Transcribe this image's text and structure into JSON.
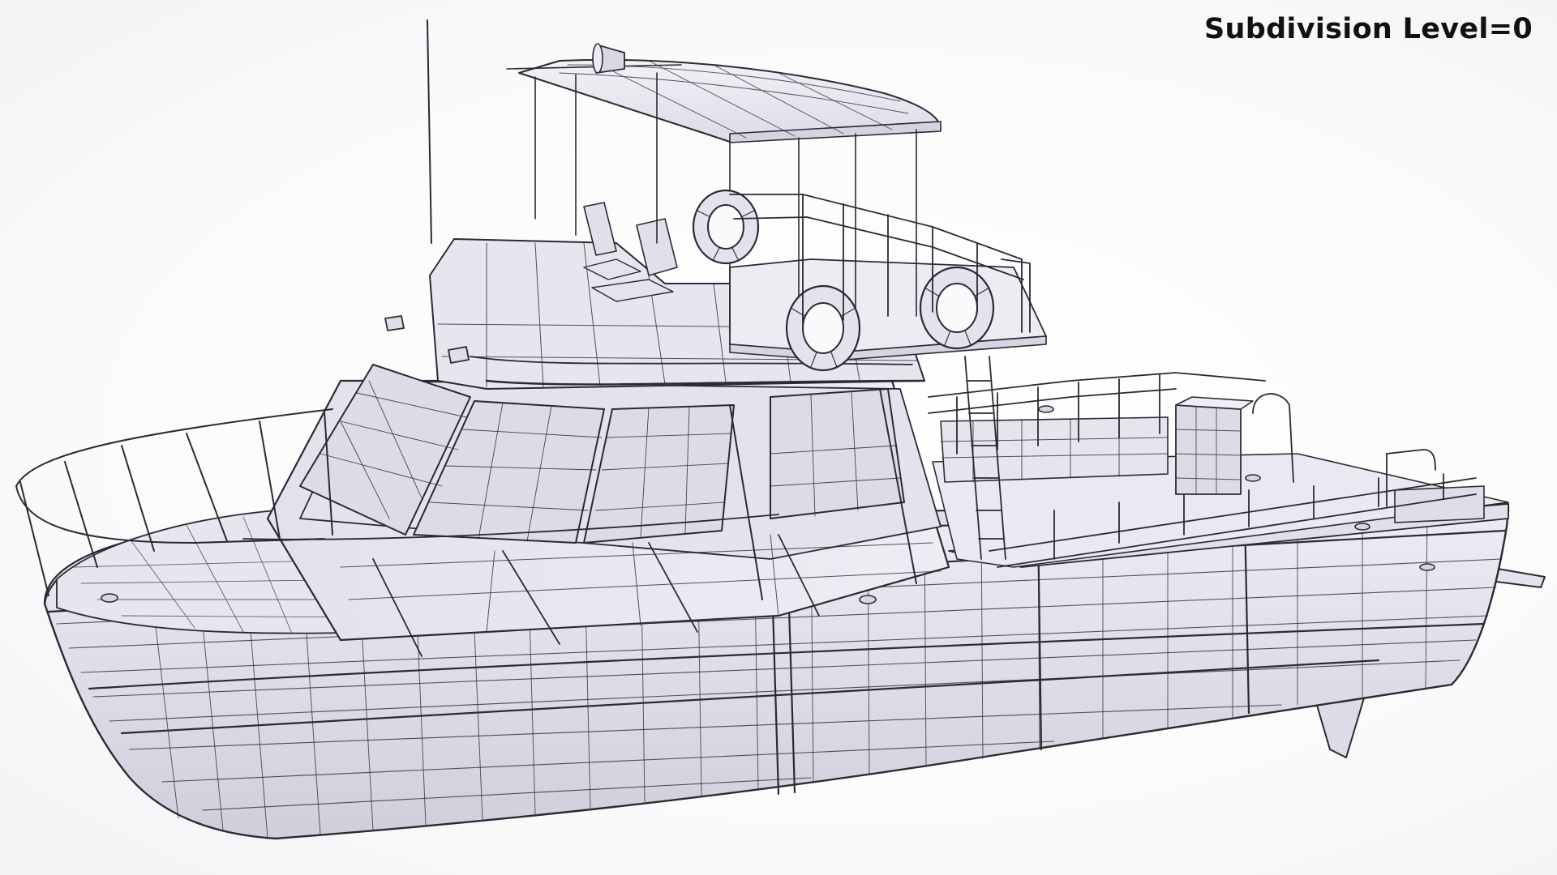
{
  "caption": "Subdivision Level=0",
  "colors": {
    "background": "#ffffff",
    "surface": "#e9e9f2",
    "surface_shadow": "#c9c9d6",
    "wire": "#2a2a33",
    "caption_text": "#111111"
  },
  "subject": "boat-wireframe-render"
}
